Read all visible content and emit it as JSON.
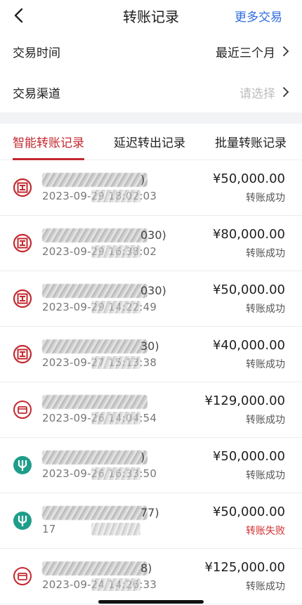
{
  "header": {
    "title": "转账记录",
    "more_label": "更多交易"
  },
  "filters": [
    {
      "label": "交易时间",
      "value": "最近三个月",
      "muted": false
    },
    {
      "label": "交易渠道",
      "value": "请选择",
      "muted": true
    }
  ],
  "tabs": [
    "智能转账记录",
    "延迟转出记录",
    "批量转账记录"
  ],
  "active_tab": 0,
  "records": [
    {
      "bank_icon": "icbc-icon",
      "name_suffix": ")",
      "time": "2023-09-29 18:02:03",
      "amount": "¥50,000.00",
      "status": "转账成功",
      "failed": false
    },
    {
      "bank_icon": "icbc-icon",
      "name_suffix": "030)",
      "time": "2023-09-29 16:38:02",
      "amount": "¥80,000.00",
      "status": "转账成功",
      "failed": false
    },
    {
      "bank_icon": "icbc-icon",
      "name_suffix": "030)",
      "time": "2023-09-29 14:22:49",
      "amount": "¥50,000.00",
      "status": "转账成功",
      "failed": false
    },
    {
      "bank_icon": "icbc-icon",
      "name_suffix": "30)",
      "time": "2023-09-27 15:13:38",
      "amount": "¥40,000.00",
      "status": "转账成功",
      "failed": false
    },
    {
      "bank_icon": "card-icon",
      "name_suffix": "",
      "time": "2023-09-26 14:04:54",
      "amount": "¥129,000.00",
      "status": "转账成功",
      "failed": false
    },
    {
      "bank_icon": "abc-icon",
      "name_suffix": ")",
      "time": "2023-09-26 16:33:50",
      "amount": "¥50,000.00",
      "status": "转账成功",
      "failed": false
    },
    {
      "bank_icon": "abc-icon",
      "name_suffix": "77)",
      "time": "17",
      "amount": "¥50,000.00",
      "status": "转账失败",
      "failed": true
    },
    {
      "bank_icon": "card-icon",
      "name_suffix": "8)",
      "time": "2023-09-24 14:26:33",
      "amount": "¥125,000.00",
      "status": "转账成功",
      "failed": false
    }
  ],
  "colors": {
    "accent": "#c4282f",
    "link": "#2f6ce0",
    "icbc": "#c4282f",
    "abc": "#1f9d8a",
    "fail": "#d32f2f"
  }
}
